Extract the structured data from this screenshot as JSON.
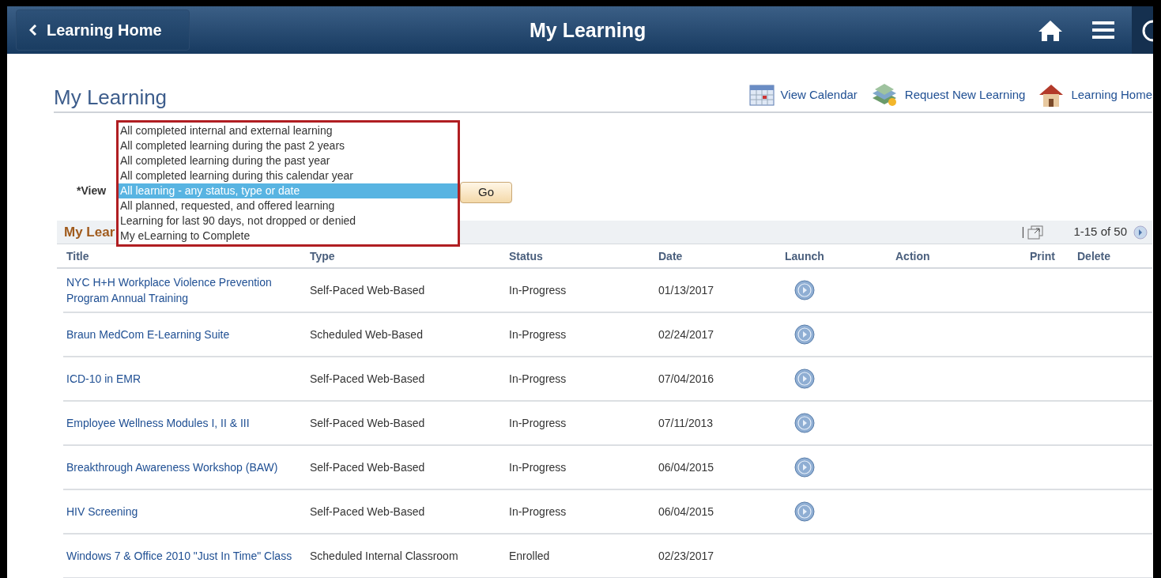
{
  "header": {
    "back_button": "Learning Home",
    "title": "My Learning"
  },
  "page_title": "My Learning",
  "links": [
    {
      "kind": "calendar",
      "label": "View Calendar"
    },
    {
      "kind": "request",
      "label": "Request New Learning"
    },
    {
      "kind": "home",
      "label": "Learning Home"
    }
  ],
  "view": {
    "label": "*View",
    "options": [
      {
        "label": "All completed internal and external learning",
        "selected": false
      },
      {
        "label": "All completed learning during the past 2 years",
        "selected": false
      },
      {
        "label": "All completed learning during the past year",
        "selected": false
      },
      {
        "label": "All completed learning during this calendar year",
        "selected": false
      },
      {
        "label": "All learning - any status, type or date",
        "selected": true
      },
      {
        "label": "All planned, requested, and offered learning",
        "selected": false
      },
      {
        "label": "Learning for last 90 days, not dropped or denied",
        "selected": false
      },
      {
        "label": "My eLearning to Complete",
        "selected": false
      }
    ],
    "go_button": "Go"
  },
  "grid": {
    "title": "My Lear",
    "separator": "|",
    "pager": "1-15 of 50",
    "columns": [
      "Title",
      "Type",
      "Status",
      "Date",
      "Launch",
      "Action",
      "Print",
      "Delete"
    ],
    "rows": [
      {
        "title": "NYC H+H Workplace Violence Prevention Program Annual Training",
        "type": "Self-Paced Web-Based",
        "status": "In-Progress",
        "date": "01/13/2017",
        "launch": true
      },
      {
        "title": "Braun MedCom E-Learning Suite",
        "type": "Scheduled Web-Based",
        "status": "In-Progress",
        "date": "02/24/2017",
        "launch": true
      },
      {
        "title": "ICD-10 in EMR",
        "type": "Self-Paced Web-Based",
        "status": "In-Progress",
        "date": "07/04/2016",
        "launch": true
      },
      {
        "title": "Employee Wellness Modules I, II & III",
        "type": "Self-Paced Web-Based",
        "status": "In-Progress",
        "date": "07/11/2013",
        "launch": true
      },
      {
        "title": "Breakthrough Awareness Workshop (BAW)",
        "type": "Self-Paced Web-Based",
        "status": "In-Progress",
        "date": "06/04/2015",
        "launch": true
      },
      {
        "title": "HIV Screening",
        "type": "Self-Paced Web-Based",
        "status": "In-Progress",
        "date": "06/04/2015",
        "launch": true
      },
      {
        "title": "Windows 7 & Office 2010 \"Just In Time\" Class",
        "type": "Scheduled Internal Classroom",
        "status": "Enrolled",
        "date": "02/23/2017",
        "launch": false
      }
    ]
  }
}
